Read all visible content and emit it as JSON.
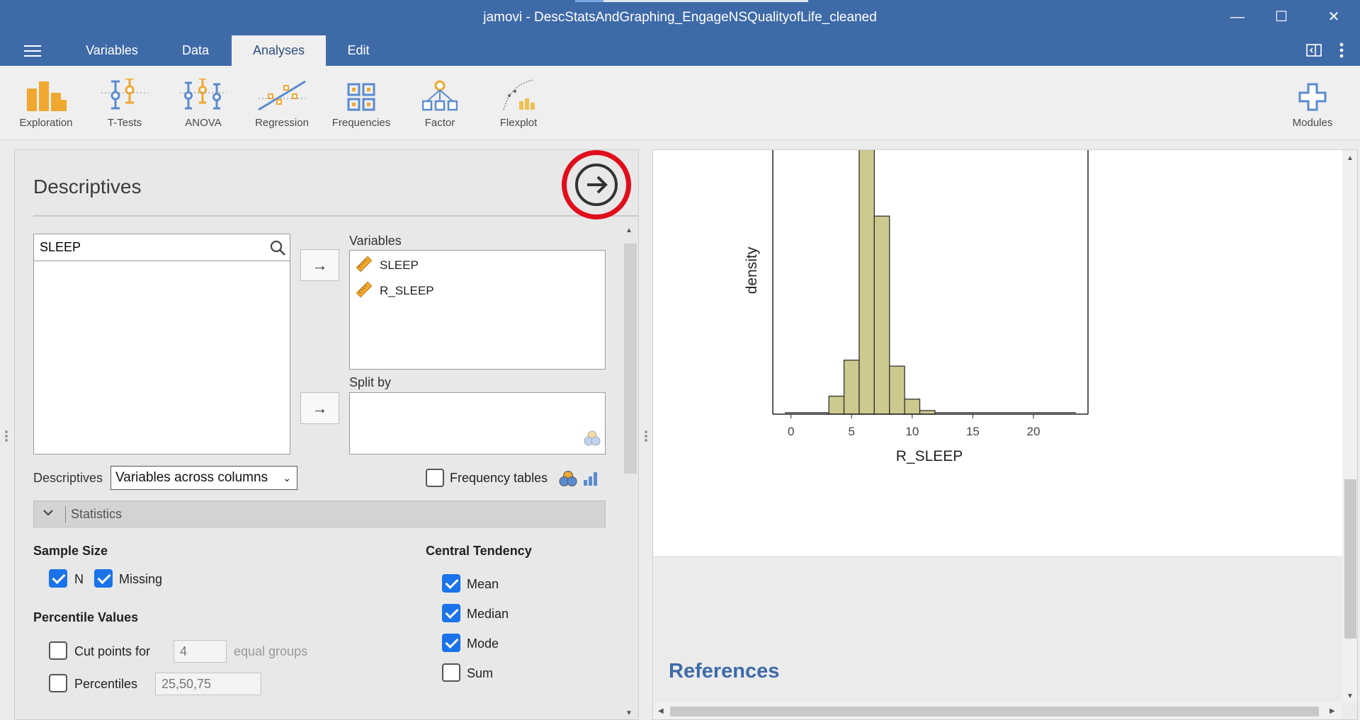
{
  "window": {
    "title": "jamovi - DescStatsAndGraphing_EngageNSQualityofLife_cleaned",
    "minimize": "—",
    "maximize": "☐",
    "close": "✕"
  },
  "menu": {
    "tabs": [
      {
        "label": "Variables"
      },
      {
        "label": "Data"
      },
      {
        "label": "Analyses"
      },
      {
        "label": "Edit"
      }
    ],
    "active_tab": "Analyses"
  },
  "ribbon": {
    "buttons": [
      {
        "label": "Exploration",
        "icon": "exploration-icon"
      },
      {
        "label": "T-Tests",
        "icon": "t-tests-icon"
      },
      {
        "label": "ANOVA",
        "icon": "anova-icon"
      },
      {
        "label": "Regression",
        "icon": "regression-icon"
      },
      {
        "label": "Frequencies",
        "icon": "frequencies-icon"
      },
      {
        "label": "Factor",
        "icon": "factor-icon"
      },
      {
        "label": "Flexplot",
        "icon": "flexplot-icon"
      }
    ],
    "modules": {
      "label": "Modules",
      "icon": "plus-icon"
    }
  },
  "descriptives": {
    "title": "Descriptives",
    "search_value": "SLEEP",
    "variables_label": "Variables",
    "variables": [
      "SLEEP",
      "R_SLEEP"
    ],
    "split_by_label": "Split by",
    "layout_label": "Descriptives",
    "layout_select": "Variables across columns",
    "frequency_tables_label": "Frequency tables",
    "frequency_tables_checked": false,
    "statistics_section": "Statistics",
    "sample_size": {
      "title": "Sample Size",
      "n_label": "N",
      "n_checked": true,
      "missing_label": "Missing",
      "missing_checked": true
    },
    "percentile_values": {
      "title": "Percentile Values",
      "cut_points_label": "Cut points for",
      "cut_points_checked": false,
      "cut_points_value": "4",
      "equal_groups_label": "equal groups",
      "percentiles_label": "Percentiles",
      "percentiles_checked": false,
      "percentiles_value": "25,50,75"
    },
    "central_tendency": {
      "title": "Central Tendency",
      "items": [
        {
          "label": "Mean",
          "checked": true
        },
        {
          "label": "Median",
          "checked": true
        },
        {
          "label": "Mode",
          "checked": true
        },
        {
          "label": "Sum",
          "checked": false
        }
      ]
    }
  },
  "results": {
    "references_title": "References"
  },
  "chart_data": {
    "type": "bar",
    "xlabel": "R_SLEEP",
    "ylabel": "density",
    "x_ticks": [
      "0",
      "5",
      "10",
      "15",
      "20"
    ],
    "xlim": [
      -1.5,
      24.5
    ],
    "bin_width": 1.25,
    "bins": [
      {
        "x": 3.75,
        "value": 0.03
      },
      {
        "x": 5.0,
        "value": 0.09
      },
      {
        "x": 6.25,
        "value": 0.62
      },
      {
        "x": 7.5,
        "value": 0.33
      },
      {
        "x": 8.75,
        "value": 0.08
      },
      {
        "x": 10.0,
        "value": 0.025
      },
      {
        "x": 11.25,
        "value": 0.006
      }
    ],
    "near_zero_range": [
      -0.5,
      23.5
    ],
    "fill": "#cdc98f",
    "stroke": "#333333"
  }
}
